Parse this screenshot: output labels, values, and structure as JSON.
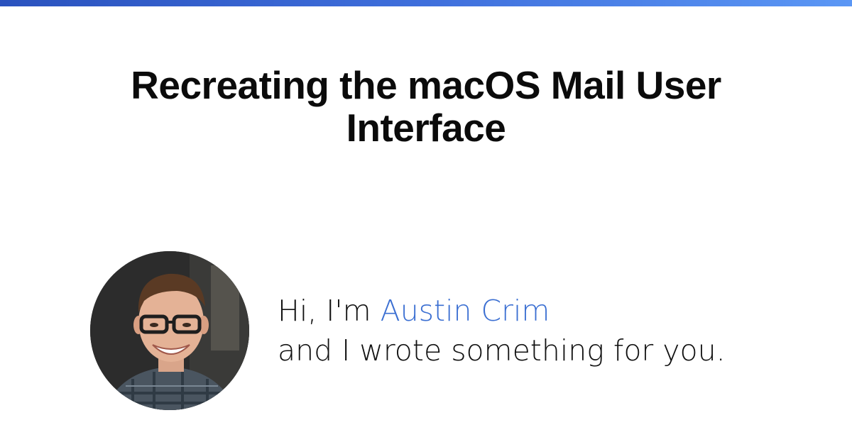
{
  "colors": {
    "accent": "#3b6fd2",
    "bar_start": "#2a52be",
    "bar_end": "#5b97f5",
    "text": "#111111"
  },
  "post": {
    "title": "Recreating the macOS Mail User Interface"
  },
  "author": {
    "greeting": "Hi, I'm",
    "name": "Austin Crim",
    "tagline": "and I wrote something for you."
  }
}
